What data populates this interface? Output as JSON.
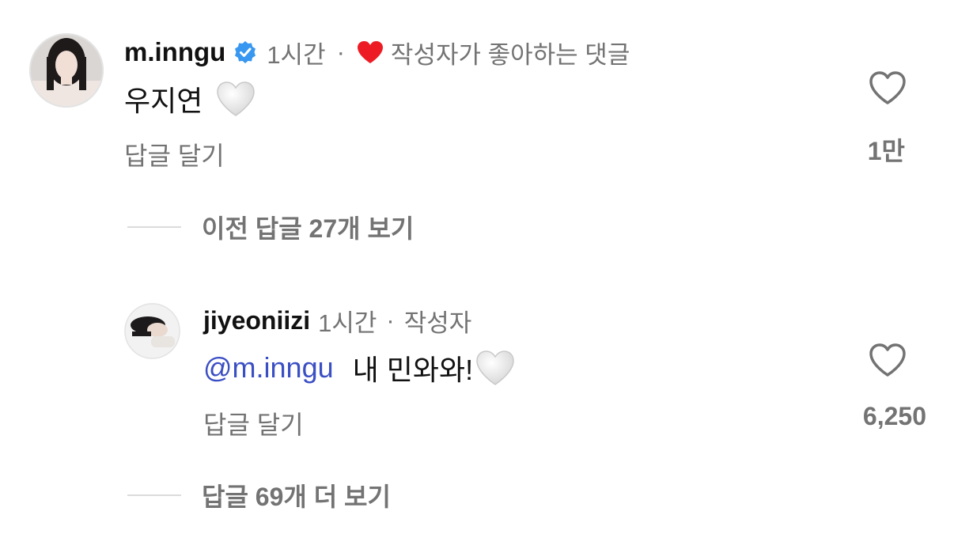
{
  "comments": [
    {
      "username": "m.inngu",
      "time": "1시간",
      "separator": "·",
      "author_liked_label": "작성자가 좋아하는 댓글",
      "text": "우지연",
      "reply_label": "답글 달기",
      "like_count": "1만"
    },
    {
      "username": "jiyeoniizi",
      "time": "1시간",
      "separator": "·",
      "author_badge": "작성자",
      "mention": "@m.inngu",
      "text": "내 민와와!",
      "reply_label": "답글 달기",
      "like_count": "6,250"
    }
  ],
  "view_previous": "이전 답글 27개 보기",
  "view_more": "답글 69개 더 보기",
  "colors": {
    "meta": "#737373",
    "mention": "#3b4fc4",
    "verified": "#3897f0",
    "heart_red": "#ed1c24",
    "divider": "#dbdbdb"
  },
  "icons": [
    "verified-badge-icon",
    "red-heart-icon",
    "white-heart-emoji",
    "heart-outline-icon"
  ]
}
